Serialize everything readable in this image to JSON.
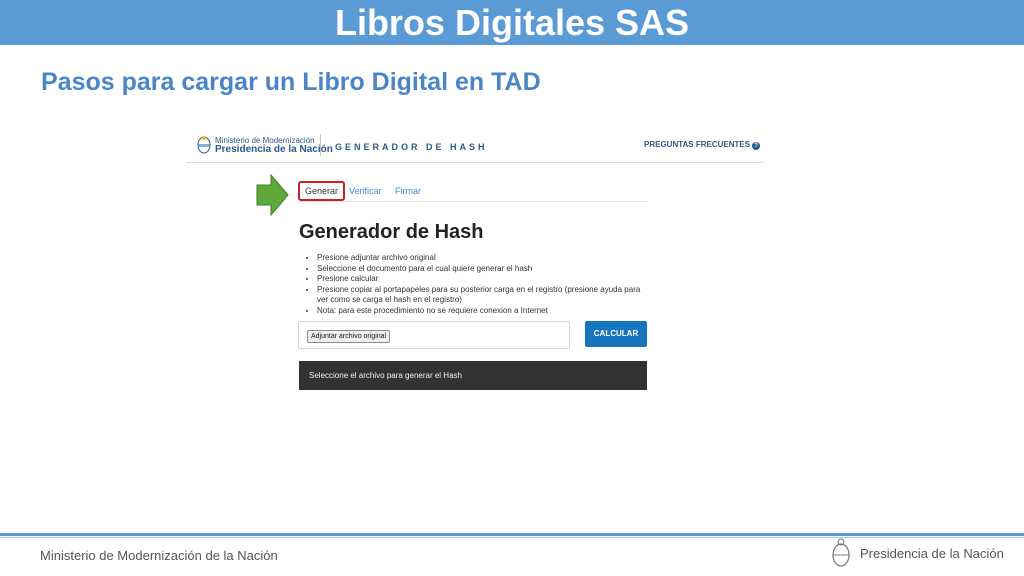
{
  "slide": {
    "title": "Libros Digitales SAS",
    "subtitle": "Pasos para cargar un Libro Digital en TAD"
  },
  "screenshot": {
    "header": {
      "ministry_line1": "Ministerio de Modernización",
      "ministry_line2": "Presidencia de la Nación",
      "app_name": "GENERADOR DE HASH",
      "faq_label": "PREGUNTAS FRECUENTES",
      "faq_icon": "question-circle-icon"
    },
    "tabs": [
      {
        "label": "Generar",
        "active": true
      },
      {
        "label": "Verificar",
        "active": false
      },
      {
        "label": "Firmar",
        "active": false
      }
    ],
    "heading": "Generador de Hash",
    "steps": [
      "Presione adjuntar archivo original",
      "Seleccione el documento para el cual quiere generar el hash",
      "Presione calcular",
      "Presione copiar al portapapeles para su posterior carga en el registro (presione ayuda para ver como se carga el hash en el registro)",
      "Nota: para este procedimiento no se requiere conexion a Internet"
    ],
    "file_button_label": "Adjuntar archivo original",
    "calculate_label": "CALCULAR",
    "result_text": "Seleccione el archivo para generar el Hash",
    "highlight_color": "#cc1f1f",
    "arrow_color": "#5fa83a",
    "accent_color": "#1775bd"
  },
  "footer": {
    "left": "Ministerio de Modernización de la Nación",
    "right": "Presidencia de la Nación"
  },
  "colors": {
    "title_bar": "#5b9bd5",
    "subtitle": "#4a86c6"
  }
}
